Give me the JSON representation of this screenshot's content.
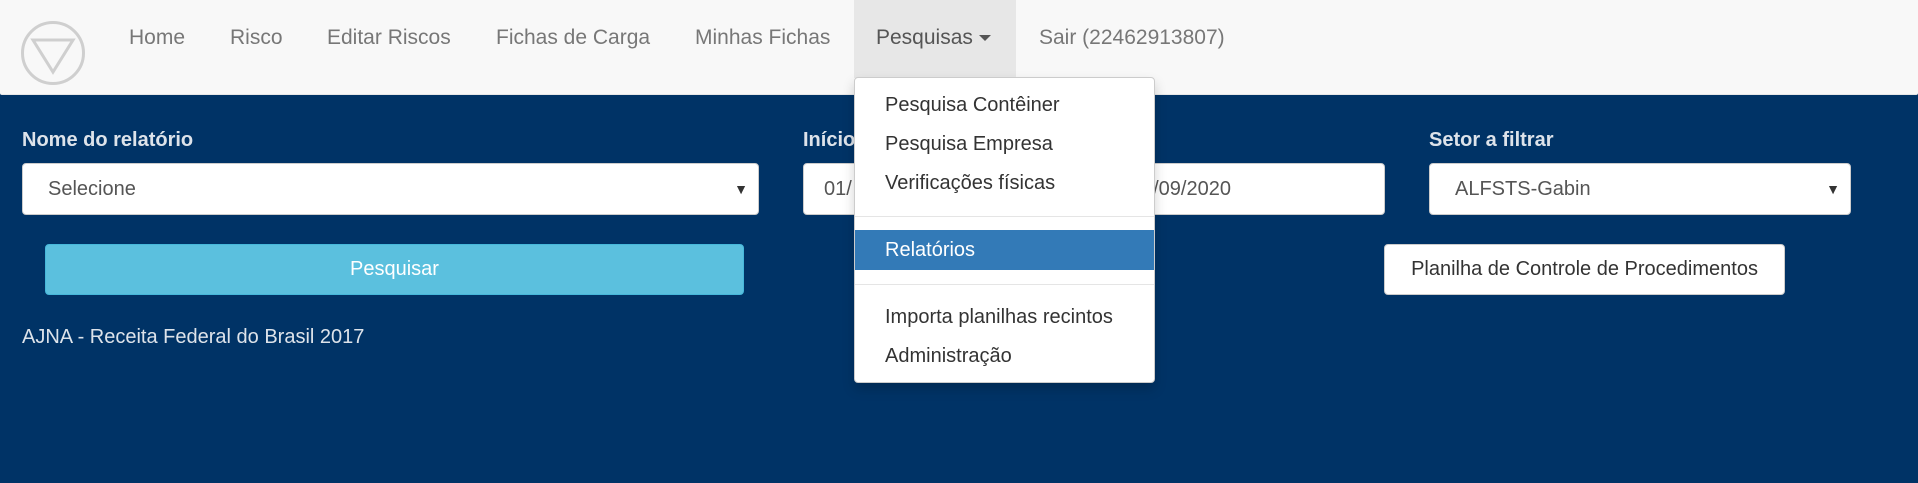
{
  "nav": {
    "items": [
      {
        "label": "Home"
      },
      {
        "label": "Risco"
      },
      {
        "label": "Editar Riscos"
      },
      {
        "label": "Fichas de Carga"
      },
      {
        "label": "Minhas Fichas"
      },
      {
        "label": "Pesquisas"
      },
      {
        "label": "Sair (22462913807)"
      }
    ],
    "logo_icon": "triangle-circle-logo"
  },
  "dropdown": {
    "items": [
      {
        "label": "Pesquisa Contêiner"
      },
      {
        "label": "Pesquisa Empresa"
      },
      {
        "label": "Verificações físicas"
      },
      {
        "label": "Relatórios"
      },
      {
        "label": "Importa planilhas recintos"
      },
      {
        "label": "Administração"
      }
    ]
  },
  "form": {
    "report_label": "Nome do relatório",
    "report_value": "Selecione",
    "start_label": "Início",
    "start_value_partial": "01/",
    "end_value_partial": "3/09/2020",
    "sector_label": "Setor a filtrar",
    "sector_value": "ALFSTS-Gabin",
    "search_button": "Pesquisar",
    "planilha_button": "Planilha de Controle de Procedimentos"
  },
  "footer": {
    "text": "AJNA - Receita Federal do Brasil 2017"
  },
  "colors": {
    "background": "#003366",
    "navbar": "#f8f8f8",
    "search_button": "#5bc0de",
    "active_item": "#337ab7"
  }
}
